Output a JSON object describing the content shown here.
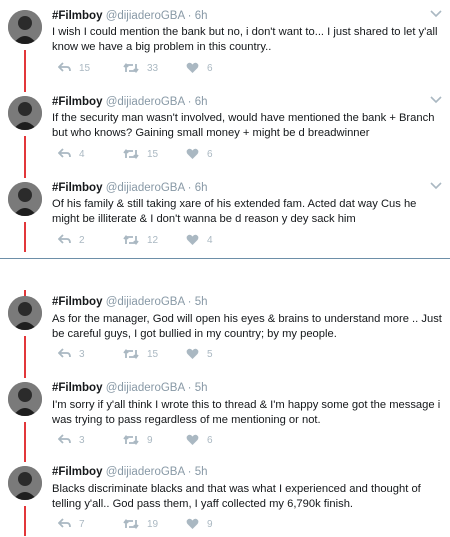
{
  "top_tweets": [
    {
      "name": "#Filmboy",
      "handle": "@dijiaderoGBA · 6h",
      "text": "I wish I could mention the bank but no, i don't want to... I just shared to let y'all know we have a big problem in this country..",
      "replies": "15",
      "retweets": "33",
      "likes": "6"
    },
    {
      "name": "#Filmboy",
      "handle": "@dijiaderoGBA · 6h",
      "text": "If the security man wasn't involved, would have mentioned the bank + Branch but who knows? Gaining small money + might be d breadwinner",
      "replies": "4",
      "retweets": "15",
      "likes": "6"
    },
    {
      "name": "#Filmboy",
      "handle": "@dijiaderoGBA · 6h",
      "text": "Of his family & still taking xare of his extended fam. Acted dat way Cus he might be illiterate & I don't wanna be d reason y dey sack him",
      "replies": "2",
      "retweets": "12",
      "likes": "4"
    }
  ],
  "bottom_tweets": [
    {
      "name": "#Filmboy",
      "handle": "@dijiaderoGBA · 5h",
      "text": "As for the manager, God will open his eyes & brains to understand more .. Just be careful guys, I got bullied in my country; by my people.",
      "replies": "3",
      "retweets": "15",
      "likes": "5"
    },
    {
      "name": "#Filmboy",
      "handle": "@dijiaderoGBA · 5h",
      "text": "I'm sorry if y'all think I wrote this to thread & I'm happy some got the message i was trying to pass regardless of me mentioning or not.",
      "replies": "3",
      "retweets": "9",
      "likes": "6"
    },
    {
      "name": "#Filmboy",
      "handle": "@dijiaderoGBA · 5h",
      "text": "Blacks discriminate blacks and that was what I experienced and thought of telling y'all.. God pass them, I yaff collected my 6,790k finish.",
      "replies": "7",
      "retweets": "19",
      "likes": "9"
    }
  ],
  "colors": {
    "thread_line": "#e2373a",
    "muted": "#8899a6",
    "icon": "#aab8c2"
  },
  "icons": [
    "reply-icon",
    "retweet-icon",
    "like-icon",
    "chevron-down-icon",
    "avatar"
  ]
}
